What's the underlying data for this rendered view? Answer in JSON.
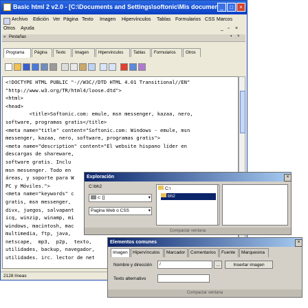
{
  "window": {
    "title": "Basic html 2 v2.0 - [C:\\Documents and Settings\\softonic\\Mis documen..."
  },
  "menu": [
    "Archivo",
    "Edición",
    "Ver",
    "Página",
    "Texto",
    "Imagen",
    "Hipervínculos",
    "Tablas",
    "Formularios",
    "CSS",
    "Marcos",
    "Otros",
    "Ayuda"
  ],
  "panel": {
    "title": "Pestañas"
  },
  "tabs": [
    "Programa",
    "Página",
    "Texto",
    "Imagen",
    "Hipervínculos",
    "Tablas",
    "Formularios",
    "Otros"
  ],
  "editor": {
    "lines": [
      "<!DOCTYPE HTML PUBLIC \"-//W3C//DTD HTML 4.01 Transitional//EN\"",
      "\"http://www.w3.org/TR/html4/loose.dtd\">",
      "<html>",
      "<head>",
      "        <title>Softonic.com: emule, msn messenger, kazaa, nero,",
      "software, programas gratis</title>",
      "<meta name=\"title\" content=\"Softonic.com: Windows - emule, msn",
      "messenger, kazaa, nero, software, programas gratis\">",
      "<meta name=\"description\" content=\"El website hispano líder en",
      "descargas de shareware,",
      "software gratis. Inclu",
      "msn messenger. Todo en",
      "áreas, y soporte para W",
      "PC y Móviles.\">",
      "<meta name=\"keywords\" c",
      "gratis, msn messenger,",
      "divx, juegos, salvapant",
      "icq, winzip, winamp, mi",
      "windows, macintosh, mac",
      "multimedia, ftp, java,",
      "netscape,  mp3,  p2p,  texto,",
      "utilidades, backup, navegador,",
      "utilidades. irc. lector de net"
    ]
  },
  "status": {
    "lines": "2128 líneas"
  },
  "explorer": {
    "title": "Exploración",
    "path": "C:\\bh2",
    "drive": "c: []",
    "filter": "Pagina Web o CSS",
    "folders": [
      "C:\\",
      "bh2"
    ],
    "compact": "Compactar ventana"
  },
  "common": {
    "title": "Elementos comunes",
    "tabs": [
      "Imagen",
      "Hipervínculos",
      "Marcador",
      "Comentarios",
      "Fuente",
      "Marquesina"
    ],
    "name_label": "Nombre y dirección",
    "name_value": "/",
    "browse": "...",
    "insert": "Insertar imagen",
    "alt_label": "Texto alternativo",
    "compact": "Compactar ventana"
  }
}
